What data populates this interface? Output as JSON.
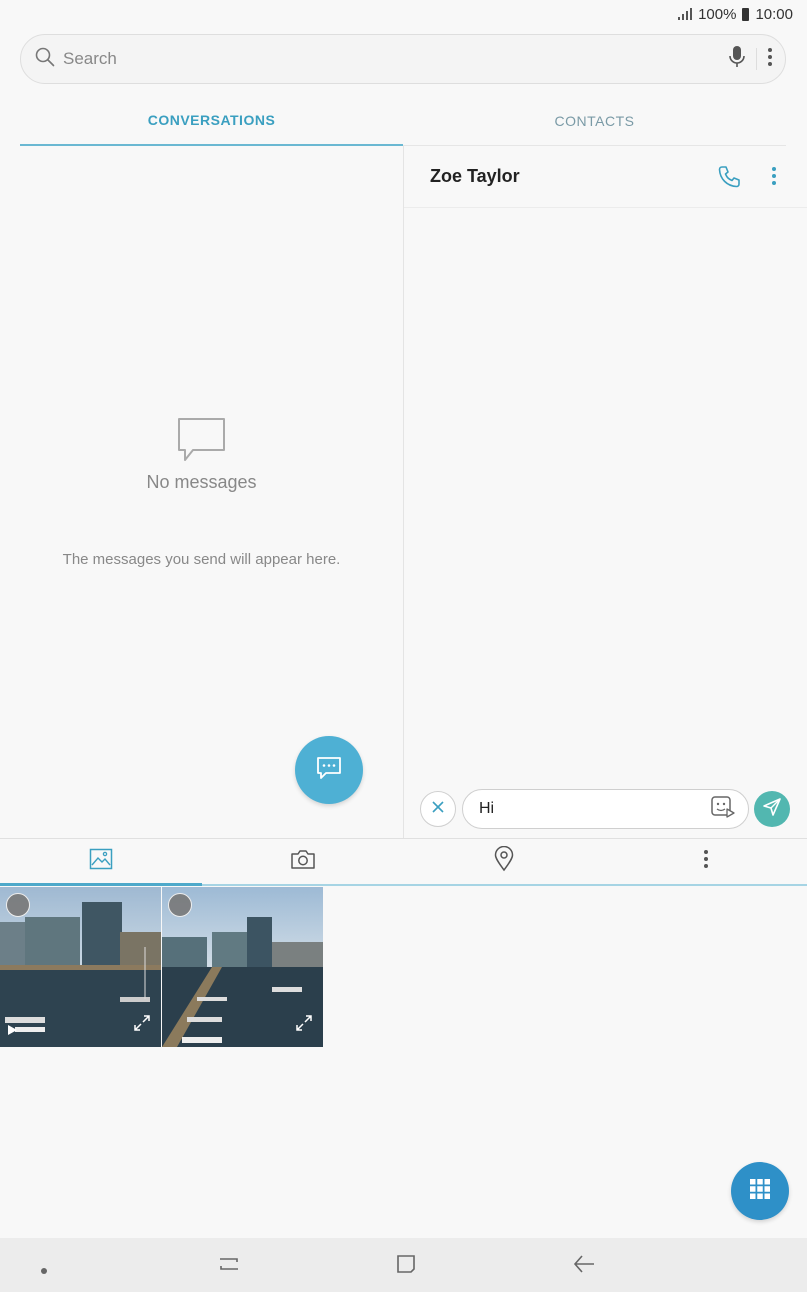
{
  "status_bar": {
    "battery": "100%",
    "time": "10:00"
  },
  "search": {
    "placeholder": "Search"
  },
  "tabs": [
    {
      "label": "CONVERSATIONS",
      "active": true
    },
    {
      "label": "CONTACTS",
      "active": false
    }
  ],
  "empty_state": {
    "title": "No messages",
    "subtitle": "The messages you send will appear here."
  },
  "conversation": {
    "contact_name": "Zoe Taylor",
    "message_input_value": "Hi"
  },
  "attach_tabs": [
    "gallery-icon",
    "camera-icon",
    "location-icon",
    "more-icon"
  ],
  "gallery": {
    "items": 2
  },
  "colors": {
    "accent": "#3a9fc0",
    "fab": "#4eb0d4",
    "send": "#52b7b0",
    "keypad_fab": "#2e90c8"
  }
}
